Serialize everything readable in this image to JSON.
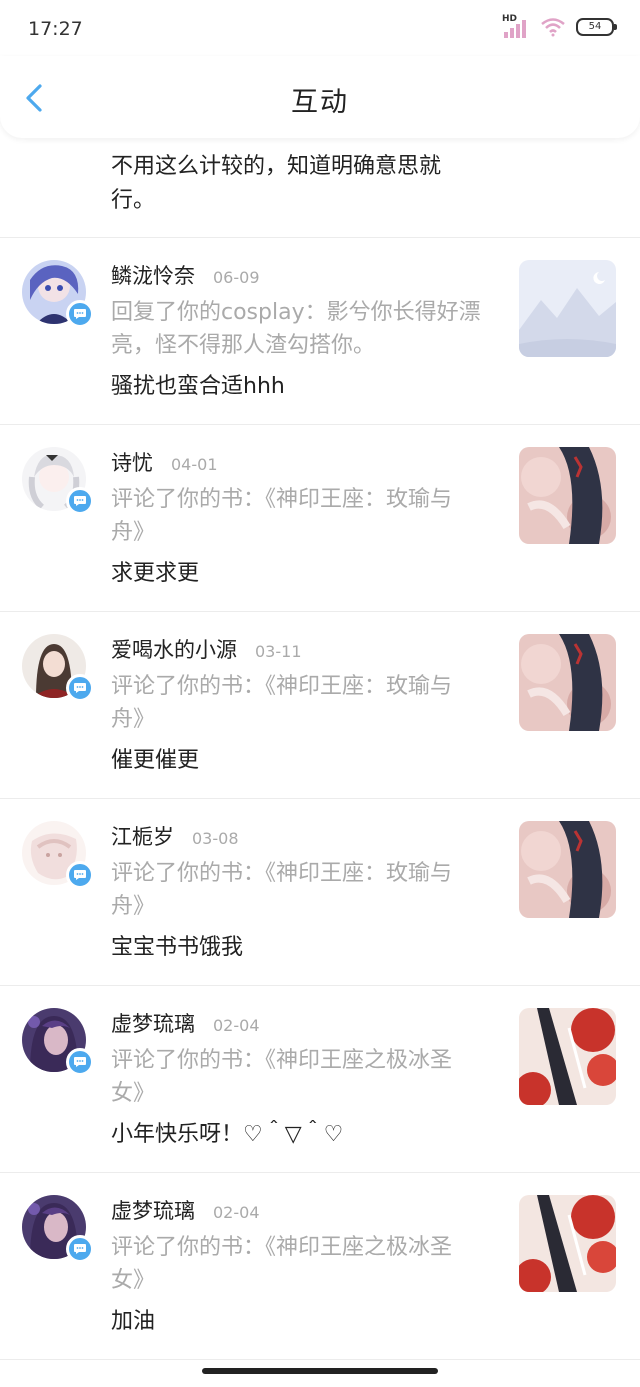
{
  "status_bar": {
    "time": "17:27",
    "network": "HD",
    "battery": "54"
  },
  "header": {
    "title": "互动"
  },
  "first_item": {
    "content": "不用这么计较的，知道明确意思就行。"
  },
  "items": [
    {
      "name": "鳞泷怜奈",
      "date": "06-09",
      "action": "回复了你的cosplay：影兮你长得好漂亮，怪不得那人渣勾搭你。",
      "reply": "骚扰也蛮合适hhh"
    },
    {
      "name": "诗忧",
      "date": "04-01",
      "action": "评论了你的书：《神印王座：玫瑜与舟》",
      "reply": "求更求更"
    },
    {
      "name": "爱喝水的小源",
      "date": "03-11",
      "action": "评论了你的书：《神印王座：玫瑜与舟》",
      "reply": "催更催更"
    },
    {
      "name": "江栀岁",
      "date": "03-08",
      "action": "评论了你的书：《神印王座：玫瑜与舟》",
      "reply": "宝宝书书饿我"
    },
    {
      "name": "虚梦琉璃",
      "date": "02-04",
      "action": "评论了你的书：《神印王座之极冰圣女》",
      "reply": "小年快乐呀！♡＾▽＾♡"
    },
    {
      "name": "虚梦琉璃",
      "date": "02-04",
      "action": "评论了你的书：《神印王座之极冰圣女》",
      "reply": "加油"
    }
  ],
  "colors": {
    "accent": "#4da9ee",
    "muted_text": "#aaaaaa",
    "primary_text": "#222222"
  }
}
